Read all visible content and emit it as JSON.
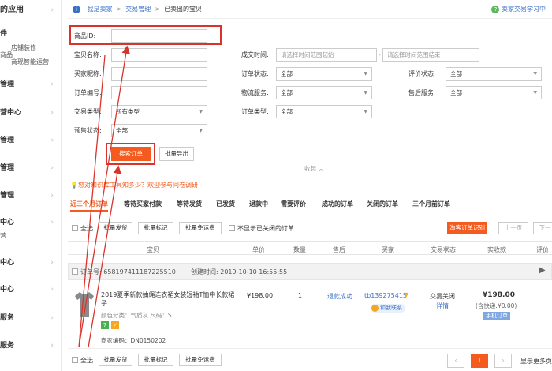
{
  "sidebar": {
    "items": [
      {
        "label": "的应用"
      },
      {
        "label": "件"
      },
      {
        "label": "管理"
      },
      {
        "label": "营中心"
      },
      {
        "label": "管理"
      },
      {
        "label": "管理"
      },
      {
        "label": "管理"
      },
      {
        "label": "中心"
      },
      {
        "label": "中心"
      },
      {
        "label": "中心"
      },
      {
        "label": "服务"
      },
      {
        "label": "服务"
      }
    ],
    "subs": [
      "店铺装修",
      "商品",
      "商现智能运营",
      "营"
    ]
  },
  "breadcrumb": {
    "home": "我是卖家",
    "section": "交易管理",
    "current": "已卖出的宝贝"
  },
  "help_link": "卖家交易学习中",
  "form": {
    "product_id_label": "商品ID:",
    "item_name_label": "宝贝名称:",
    "buyer_nick_label": "买家昵称:",
    "order_no_label": "订单编号:",
    "trade_type_label": "交易类型:",
    "trade_type_value": "所有类型",
    "presale_label": "预售状态:",
    "presale_value": "全部",
    "deal_time_label": "成交时间:",
    "time_start_placeholder": "请选择时间范围起始",
    "time_end_placeholder": "请选择时间范围结束",
    "order_status_label": "订单状态:",
    "order_status_value": "全部",
    "logistics_label": "物流服务:",
    "logistics_value": "全部",
    "order_type_label": "订单类型:",
    "order_type_value": "全部",
    "review_label": "评价状态:",
    "review_value": "全部",
    "aftersale_label": "售后服务:",
    "aftersale_value": "全部",
    "search_button": "搜索订单",
    "export_button": "批量导出",
    "collapse": "收起"
  },
  "notice": "您对知识库工具知多少？欢迎参与问卷调研",
  "tabs": [
    "近三个月订单",
    "等待买家付款",
    "等待发货",
    "已发货",
    "退款中",
    "需要评价",
    "成功的订单",
    "关闭的订单",
    "三个月前订单"
  ],
  "toolbar": {
    "select_all": "全选",
    "batch_ship": "批量发货",
    "batch_mark": "批量标记",
    "batch_free": "批量免运费",
    "hide_closed": "不显示已关闭的订单",
    "taobao_assist": "淘客订单识别",
    "prev": "上一页",
    "next": "下一"
  },
  "columns": [
    "宝贝",
    "单价",
    "数量",
    "售后",
    "买家",
    "交易状态",
    "实收款",
    "评价"
  ],
  "order": {
    "order_no_label": "订单号:",
    "order_no": "658197411187225510",
    "created_label": "创建时间:",
    "created": "2019-10-10 16:55:55",
    "title": "2019夏季新款抽绳连衣裙女装短袖T恤中长款裙子",
    "attrs": "颜色分类：气质灰  尺码：S",
    "merchant_code": "商家编码：DN0150202",
    "price": "¥198.00",
    "qty": "1",
    "aftersale": "退款成功",
    "buyer": "tb139275415",
    "contact": "和我联系",
    "status": "交易关闭",
    "detail": "详情",
    "paid": "¥198.00",
    "shipping": "(含快递:¥0.00)",
    "device": "手机订单"
  },
  "bottom": {
    "select_all": "全选",
    "batch_ship": "批量发货",
    "batch_mark": "批量标记",
    "batch_free": "批量免运费",
    "page": "1",
    "more": "显示更多页"
  },
  "colors": {
    "accent_red": "#d9342b",
    "orange": "#f55a1e",
    "link_blue": "#3a6fc4"
  }
}
